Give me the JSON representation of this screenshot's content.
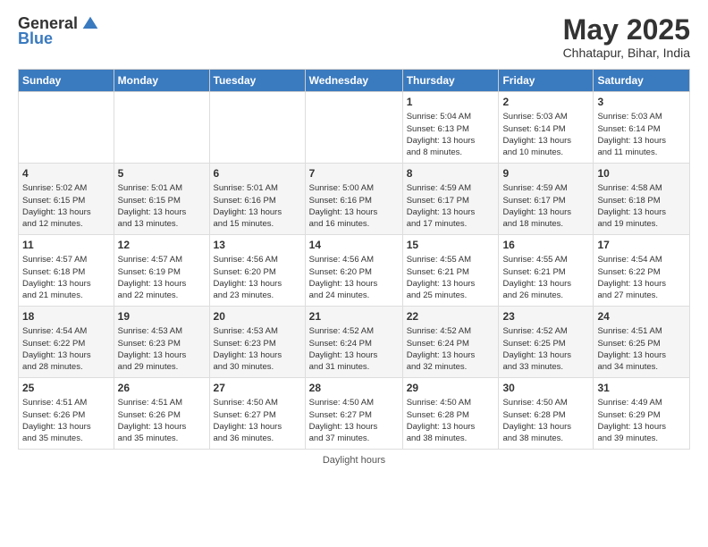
{
  "header": {
    "logo_general": "General",
    "logo_blue": "Blue",
    "month_title": "May 2025",
    "subtitle": "Chhatapur, Bihar, India"
  },
  "days_of_week": [
    "Sunday",
    "Monday",
    "Tuesday",
    "Wednesday",
    "Thursday",
    "Friday",
    "Saturday"
  ],
  "weeks": [
    [
      {
        "day": "",
        "info": ""
      },
      {
        "day": "",
        "info": ""
      },
      {
        "day": "",
        "info": ""
      },
      {
        "day": "",
        "info": ""
      },
      {
        "day": "1",
        "info": "Sunrise: 5:04 AM\nSunset: 6:13 PM\nDaylight: 13 hours\nand 8 minutes."
      },
      {
        "day": "2",
        "info": "Sunrise: 5:03 AM\nSunset: 6:14 PM\nDaylight: 13 hours\nand 10 minutes."
      },
      {
        "day": "3",
        "info": "Sunrise: 5:03 AM\nSunset: 6:14 PM\nDaylight: 13 hours\nand 11 minutes."
      }
    ],
    [
      {
        "day": "4",
        "info": "Sunrise: 5:02 AM\nSunset: 6:15 PM\nDaylight: 13 hours\nand 12 minutes."
      },
      {
        "day": "5",
        "info": "Sunrise: 5:01 AM\nSunset: 6:15 PM\nDaylight: 13 hours\nand 13 minutes."
      },
      {
        "day": "6",
        "info": "Sunrise: 5:01 AM\nSunset: 6:16 PM\nDaylight: 13 hours\nand 15 minutes."
      },
      {
        "day": "7",
        "info": "Sunrise: 5:00 AM\nSunset: 6:16 PM\nDaylight: 13 hours\nand 16 minutes."
      },
      {
        "day": "8",
        "info": "Sunrise: 4:59 AM\nSunset: 6:17 PM\nDaylight: 13 hours\nand 17 minutes."
      },
      {
        "day": "9",
        "info": "Sunrise: 4:59 AM\nSunset: 6:17 PM\nDaylight: 13 hours\nand 18 minutes."
      },
      {
        "day": "10",
        "info": "Sunrise: 4:58 AM\nSunset: 6:18 PM\nDaylight: 13 hours\nand 19 minutes."
      }
    ],
    [
      {
        "day": "11",
        "info": "Sunrise: 4:57 AM\nSunset: 6:18 PM\nDaylight: 13 hours\nand 21 minutes."
      },
      {
        "day": "12",
        "info": "Sunrise: 4:57 AM\nSunset: 6:19 PM\nDaylight: 13 hours\nand 22 minutes."
      },
      {
        "day": "13",
        "info": "Sunrise: 4:56 AM\nSunset: 6:20 PM\nDaylight: 13 hours\nand 23 minutes."
      },
      {
        "day": "14",
        "info": "Sunrise: 4:56 AM\nSunset: 6:20 PM\nDaylight: 13 hours\nand 24 minutes."
      },
      {
        "day": "15",
        "info": "Sunrise: 4:55 AM\nSunset: 6:21 PM\nDaylight: 13 hours\nand 25 minutes."
      },
      {
        "day": "16",
        "info": "Sunrise: 4:55 AM\nSunset: 6:21 PM\nDaylight: 13 hours\nand 26 minutes."
      },
      {
        "day": "17",
        "info": "Sunrise: 4:54 AM\nSunset: 6:22 PM\nDaylight: 13 hours\nand 27 minutes."
      }
    ],
    [
      {
        "day": "18",
        "info": "Sunrise: 4:54 AM\nSunset: 6:22 PM\nDaylight: 13 hours\nand 28 minutes."
      },
      {
        "day": "19",
        "info": "Sunrise: 4:53 AM\nSunset: 6:23 PM\nDaylight: 13 hours\nand 29 minutes."
      },
      {
        "day": "20",
        "info": "Sunrise: 4:53 AM\nSunset: 6:23 PM\nDaylight: 13 hours\nand 30 minutes."
      },
      {
        "day": "21",
        "info": "Sunrise: 4:52 AM\nSunset: 6:24 PM\nDaylight: 13 hours\nand 31 minutes."
      },
      {
        "day": "22",
        "info": "Sunrise: 4:52 AM\nSunset: 6:24 PM\nDaylight: 13 hours\nand 32 minutes."
      },
      {
        "day": "23",
        "info": "Sunrise: 4:52 AM\nSunset: 6:25 PM\nDaylight: 13 hours\nand 33 minutes."
      },
      {
        "day": "24",
        "info": "Sunrise: 4:51 AM\nSunset: 6:25 PM\nDaylight: 13 hours\nand 34 minutes."
      }
    ],
    [
      {
        "day": "25",
        "info": "Sunrise: 4:51 AM\nSunset: 6:26 PM\nDaylight: 13 hours\nand 35 minutes."
      },
      {
        "day": "26",
        "info": "Sunrise: 4:51 AM\nSunset: 6:26 PM\nDaylight: 13 hours\nand 35 minutes."
      },
      {
        "day": "27",
        "info": "Sunrise: 4:50 AM\nSunset: 6:27 PM\nDaylight: 13 hours\nand 36 minutes."
      },
      {
        "day": "28",
        "info": "Sunrise: 4:50 AM\nSunset: 6:27 PM\nDaylight: 13 hours\nand 37 minutes."
      },
      {
        "day": "29",
        "info": "Sunrise: 4:50 AM\nSunset: 6:28 PM\nDaylight: 13 hours\nand 38 minutes."
      },
      {
        "day": "30",
        "info": "Sunrise: 4:50 AM\nSunset: 6:28 PM\nDaylight: 13 hours\nand 38 minutes."
      },
      {
        "day": "31",
        "info": "Sunrise: 4:49 AM\nSunset: 6:29 PM\nDaylight: 13 hours\nand 39 minutes."
      }
    ]
  ],
  "footer": {
    "label": "Daylight hours"
  }
}
